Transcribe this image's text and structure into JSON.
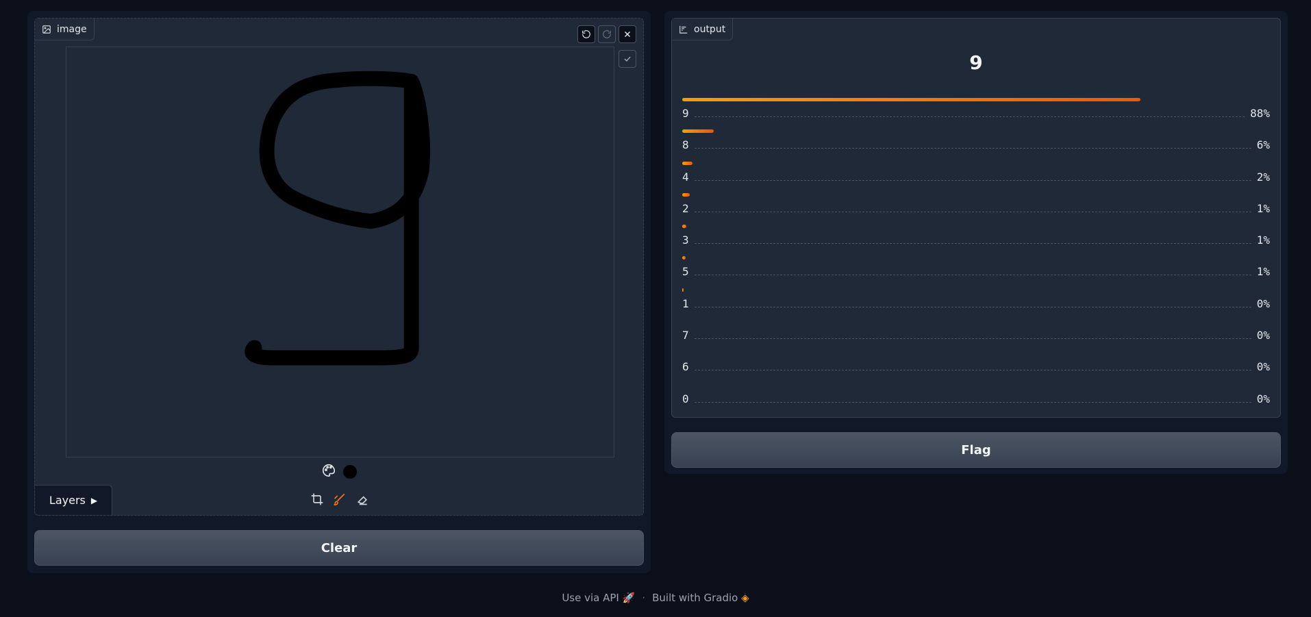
{
  "input": {
    "label": "image",
    "layers_label": "Layers",
    "brush_color": "#000000",
    "clear_label": "Clear"
  },
  "output": {
    "label": "output",
    "top_class": "9",
    "accent": "#f97316",
    "confidences": [
      {
        "label": "9",
        "value": 0.88,
        "pct": "88%"
      },
      {
        "label": "8",
        "value": 0.06,
        "pct": "6%"
      },
      {
        "label": "4",
        "value": 0.02,
        "pct": "2%"
      },
      {
        "label": "2",
        "value": 0.014,
        "pct": "1%"
      },
      {
        "label": "3",
        "value": 0.008,
        "pct": "1%"
      },
      {
        "label": "5",
        "value": 0.006,
        "pct": "1%"
      },
      {
        "label": "1",
        "value": 0.002,
        "pct": "0%"
      },
      {
        "label": "7",
        "value": 0,
        "pct": "0%"
      },
      {
        "label": "6",
        "value": 0,
        "pct": "0%"
      },
      {
        "label": "0",
        "value": 0,
        "pct": "0%"
      }
    ],
    "flag_label": "Flag"
  },
  "footer": {
    "api_label": "Use via API",
    "separator": "·",
    "built_label": "Built with Gradio"
  }
}
